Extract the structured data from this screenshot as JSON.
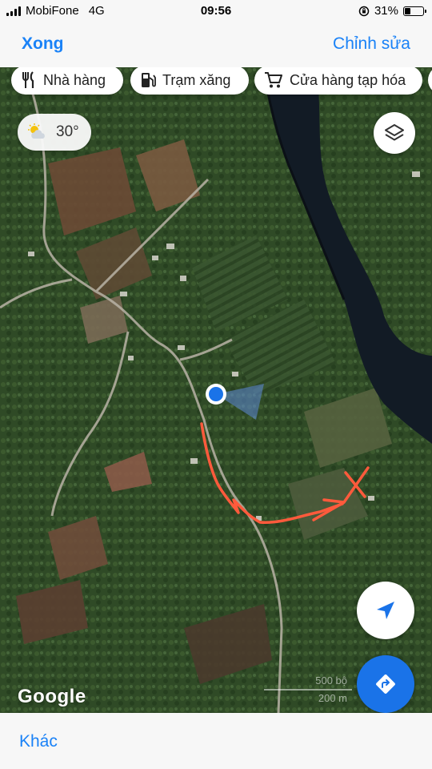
{
  "status_bar": {
    "carrier": "MobiFone",
    "network": "4G",
    "time": "09:56",
    "battery_percent": "31%",
    "battery_level": 0.31
  },
  "nav": {
    "done_label": "Xong",
    "edit_label": "Chỉnh sửa"
  },
  "categories": [
    {
      "label": "Nhà hàng",
      "icon": "fork-knife-icon"
    },
    {
      "label": "Trạm xăng",
      "icon": "gas-pump-icon"
    },
    {
      "label": "Cửa hàng tạp hóa",
      "icon": "cart-icon"
    }
  ],
  "weather": {
    "temperature": "30°",
    "icon": "partly-cloudy-icon"
  },
  "map": {
    "attribution": "Google",
    "scale_primary": "500 bộ",
    "scale_secondary": "200 m",
    "accent_color": "#1a73e8",
    "annotation_color": "#ff5a3c"
  },
  "bottom": {
    "more_label": "Khác"
  }
}
